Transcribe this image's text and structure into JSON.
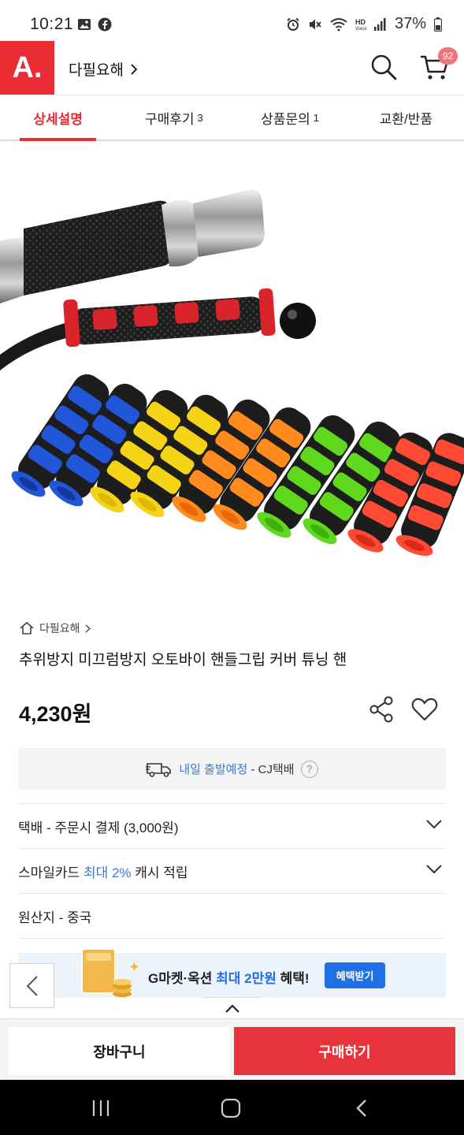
{
  "status_bar": {
    "time": "10:21",
    "battery": "37%"
  },
  "header": {
    "logo": "A.",
    "store_name": "다필요해",
    "cart_count": "92"
  },
  "tabs": [
    {
      "label": "상세설명",
      "count": ""
    },
    {
      "label": "구매후기",
      "count": "3"
    },
    {
      "label": "상품문의",
      "count": "1"
    },
    {
      "label": "교환/반품",
      "count": ""
    }
  ],
  "product": {
    "breadcrumb": "다필요해",
    "title": "추위방지 미끄럼방지 오토바이 핸들그립 커버 튜닝 핸",
    "price": "4,230원"
  },
  "delivery": {
    "highlight": "내일 출발예정",
    "carrier": " - CJ택배",
    "help": "?"
  },
  "info_rows": {
    "shipping": "택배 - 주문시 결제 (3,000원)",
    "card_prefix": "스마일카드 ",
    "card_highlight": "최대 2%",
    "card_suffix": " 캐시 적립",
    "origin": "원산지 - 중국"
  },
  "banner": {
    "text_prefix": "G마켓·옥션 ",
    "text_highlight": "최대 2만원",
    "text_suffix": " 혜택!",
    "button": "혜택받기"
  },
  "bottom": {
    "cart_label": "장바구니",
    "buy_label": "구매하기"
  },
  "colors": {
    "brand_red": "#ea2c35",
    "link_blue": "#3a7bd5"
  },
  "icons": [
    "gallery-icon",
    "facebook-icon",
    "alarm-icon",
    "mute-icon",
    "wifi-icon",
    "signal-icon",
    "battery-icon",
    "search-icon",
    "cart-icon",
    "home-icon",
    "share-icon",
    "heart-icon",
    "truck-icon",
    "chevron-down-icon",
    "back-icon",
    "chevron-up-icon"
  ]
}
